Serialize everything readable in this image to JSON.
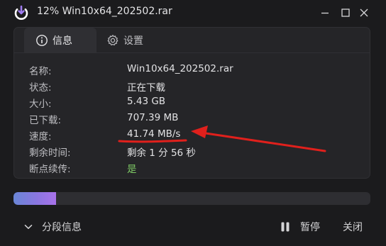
{
  "window": {
    "title": "12% Win10x64_202502.rar",
    "controls": [
      "minimize-icon",
      "maximize-icon",
      "close-icon"
    ]
  },
  "tabs": [
    {
      "label": "信息",
      "icon": "info-icon",
      "active": true
    },
    {
      "label": "设置",
      "icon": "gear-icon",
      "active": false
    }
  ],
  "details": [
    {
      "key": "名称:",
      "value": "Win10x64_202502.rar"
    },
    {
      "key": "状态:",
      "value": "正在下载"
    },
    {
      "key": "大小:",
      "value": "5.43 GB"
    },
    {
      "key": "已下载:",
      "value": "707.39 MB"
    },
    {
      "key": "速度:",
      "value": "41.74 MB/s"
    },
    {
      "key": "剩余时间:",
      "value": "剩余 1 分 56 秒"
    },
    {
      "key": "断点续传:",
      "value": "是"
    }
  ],
  "progress": {
    "fraction": 0.12
  },
  "footer": {
    "segments_label": "分段信息",
    "pause_label": "暂停",
    "close_label": "关闭"
  },
  "colors": {
    "background": "#1b1b1d",
    "panel": "#252528",
    "resume_yes": "#7dc864",
    "annotation": "#e0201c",
    "progress_start": "#6a86d6",
    "progress_end": "#a872ea"
  }
}
